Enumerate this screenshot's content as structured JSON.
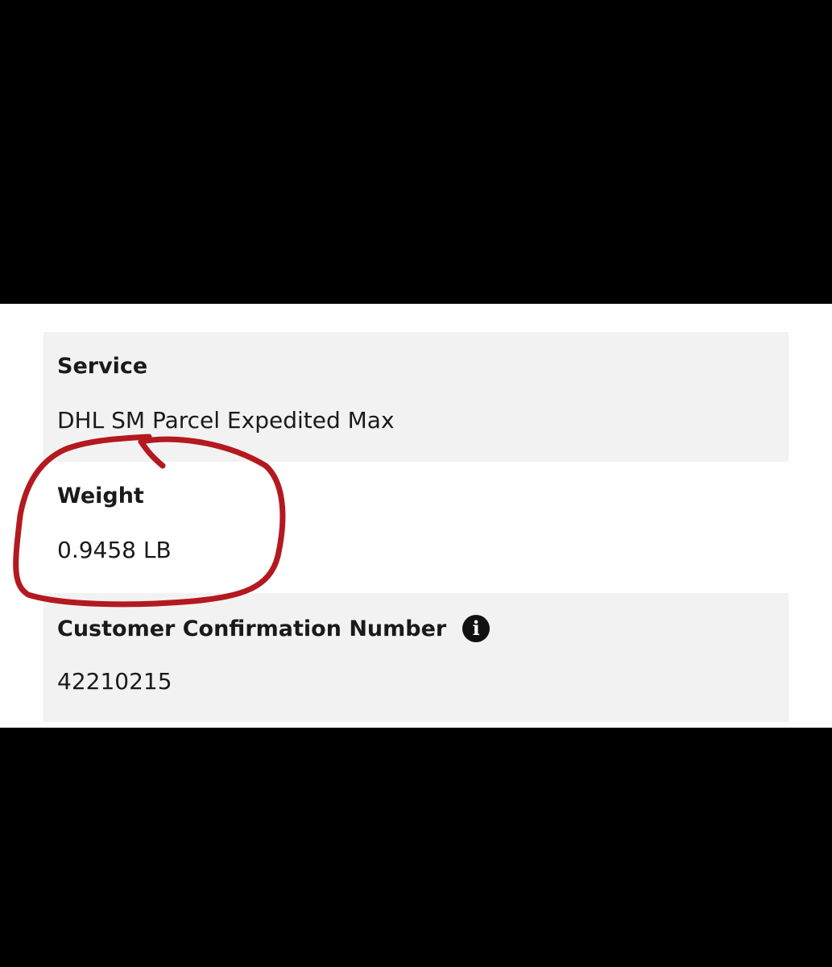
{
  "fields": {
    "service": {
      "label": "Service",
      "value": "DHL SM Parcel Expedited Max"
    },
    "weight": {
      "label": "Weight",
      "value": "0.9458 LB"
    },
    "customer_confirmation": {
      "label": "Customer Confirmation Number",
      "value": "42210215",
      "icon": "info-icon",
      "icon_glyph": "i"
    }
  },
  "annotation": {
    "shape": "hand-drawn-circle",
    "target": "weight",
    "color": "#b3191f"
  },
  "colors": {
    "row_shade": "#f2f2f2",
    "panel": "#ffffff",
    "letterbox": "#000000"
  }
}
